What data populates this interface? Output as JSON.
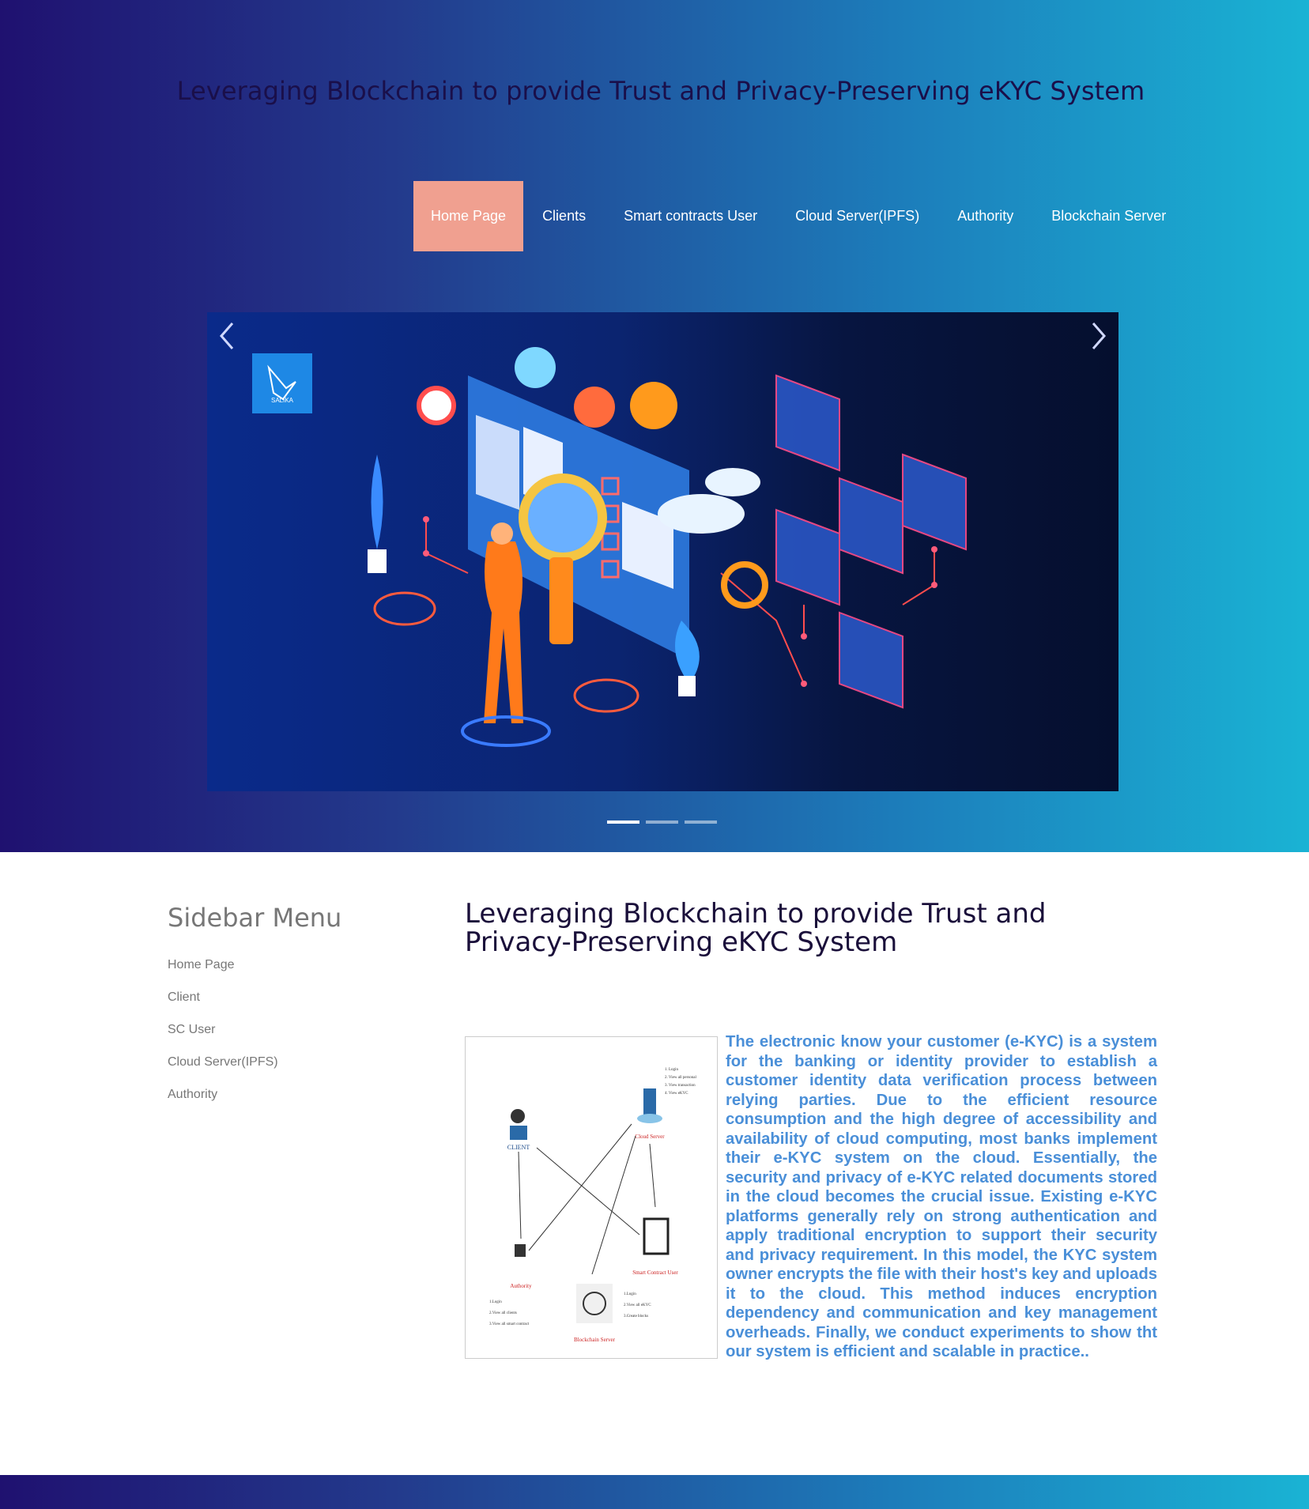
{
  "header": {
    "title": "Leveraging Blockchain to provide Trust and Privacy-Preserving eKYC System"
  },
  "nav": {
    "items": [
      {
        "label": "Home Page",
        "active": true
      },
      {
        "label": "Clients"
      },
      {
        "label": "Smart contracts User"
      },
      {
        "label": "Cloud Server(IPFS)"
      },
      {
        "label": "Authority"
      },
      {
        "label": "Blockchain Server"
      }
    ]
  },
  "carousel": {
    "logo_text": "SALIKA",
    "slide_count": 3,
    "active_slide": 1
  },
  "sidebar": {
    "title": "Sidebar Menu",
    "items": [
      {
        "label": "Home Page"
      },
      {
        "label": "Client"
      },
      {
        "label": "SC User"
      },
      {
        "label": "Cloud Server(IPFS)"
      },
      {
        "label": "Authority"
      }
    ]
  },
  "main": {
    "title": "Leveraging Blockchain to provide Trust and Privacy-Preserving eKYC System",
    "abstract": "The electronic know your customer (e-KYC) is a system for the banking or identity provider to establish a customer identity data verification process between relying parties. Due to the efficient resource consumption and the high degree of accessibility and availability of cloud computing, most banks implement their e-KYC system on the cloud. Essentially, the security and privacy of e-KYC related documents stored in the cloud becomes the crucial issue. Existing e-KYC platforms generally rely on strong authentication and apply traditional encryption to support their security and privacy requirement. In this model, the KYC system owner encrypts the file with their host's key and uploads it to the cloud. This method induces encryption dependency and communication and key management overheads. Finally, we conduct experiments to show tht our system is efficient and scalable in practice..",
    "figure": {
      "client_label": "CLIENT",
      "cloud_label": "Cloud Server",
      "authority_label": "Authority",
      "sc_label": "Smart Contract User",
      "blockchain_label": "Blockchain Server"
    }
  },
  "colors": {
    "gradient_start": "#1f1170",
    "gradient_end": "#1ab3d4",
    "nav_active": "#f0a090",
    "abstract_text": "#4a8fd8"
  }
}
